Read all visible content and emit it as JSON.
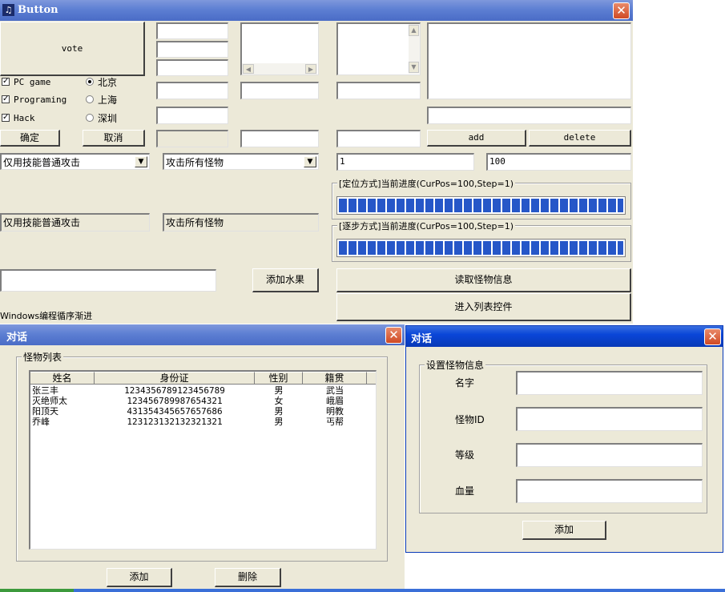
{
  "main_window": {
    "title": "Button",
    "vote_button": "vote",
    "checkboxes": [
      {
        "label": "PC game",
        "checked": true
      },
      {
        "label": "Programing",
        "checked": true
      },
      {
        "label": "Hack",
        "checked": true
      }
    ],
    "radios": [
      {
        "label": "北京",
        "selected": true
      },
      {
        "label": "上海",
        "selected": false
      },
      {
        "label": "深圳",
        "selected": false
      }
    ],
    "ok_button": "确定",
    "cancel_button": "取消",
    "add_button": "add",
    "delete_button": "delete",
    "combo1_value": "仅用技能普通攻击",
    "combo2_value": "攻击所有怪物",
    "static1": "仅用技能普通攻击",
    "static2": "攻击所有怪物",
    "edit_pos": "1",
    "edit_max": "100",
    "group_progress1": "[定位方式]当前进度(CurPos=100,Step=1)",
    "group_progress2": "[逐步方式]当前进度(CurPos=100,Step=1)",
    "progress1_percent": 100,
    "progress2_percent": 100,
    "add_fruit_button": "添加水果",
    "read_monster_button": "读取怪物信息",
    "enter_list_button": "进入列表控件",
    "footer_text": "Windows编程循序渐进"
  },
  "dialog_list": {
    "title": "对话",
    "group_label": "怪物列表",
    "columns": [
      "姓名",
      "身份证",
      "性别",
      "籍贯"
    ],
    "rows": [
      [
        "张三丰",
        "1234356789123456789",
        "男",
        "武当"
      ],
      [
        "灭绝师太",
        "123456789987654321",
        "女",
        "峨眉"
      ],
      [
        "阳顶天",
        "431354345657657686",
        "男",
        "明教"
      ],
      [
        "乔峰",
        "123123132132321321",
        "男",
        "丐帮"
      ]
    ],
    "add_button": "添加",
    "delete_button": "删除"
  },
  "dialog_info": {
    "title": "对话",
    "group_label": "设置怪物信息",
    "fields": [
      {
        "label": "名字",
        "value": ""
      },
      {
        "label": "怪物ID",
        "value": ""
      },
      {
        "label": "等级",
        "value": ""
      },
      {
        "label": "血量",
        "value": ""
      }
    ],
    "add_button": "添加"
  },
  "icons": {
    "app_icon": "music-note-icon",
    "close": "close-icon",
    "combo_arrow": "chevron-down-icon"
  },
  "colors": {
    "window_bg": "#ece9d8",
    "titlebar_active": "#0a46d8",
    "titlebar_inactive": "#7e98dc",
    "progress_fill": "#2657c8",
    "close_button": "#d04a24"
  }
}
